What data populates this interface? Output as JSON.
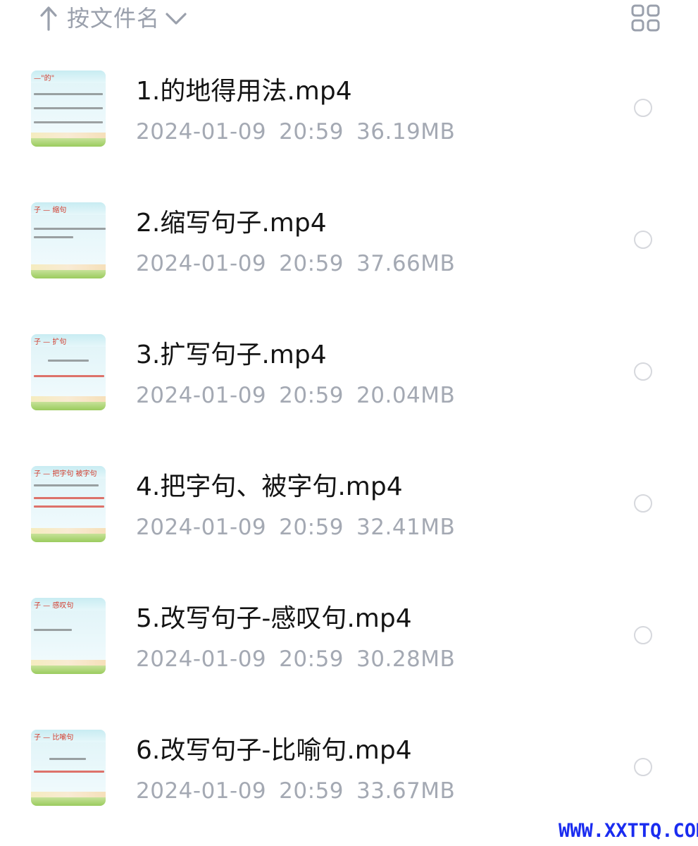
{
  "header": {
    "sort_label": "按文件名",
    "sort_direction_icon": "arrow-up-icon",
    "sort_menu_icon": "chevron-down-icon",
    "view_toggle_icon": "grid-view-icon"
  },
  "files": [
    {
      "name": "1.的地得用法.mp4",
      "date": "2024-01-09",
      "time": "20:59",
      "size": "36.19MB",
      "thumb_title": "—\"的\""
    },
    {
      "name": "2.缩写句子.mp4",
      "date": "2024-01-09",
      "time": "20:59",
      "size": "37.66MB",
      "thumb_title": "子 — 缩句"
    },
    {
      "name": "3.扩写句子.mp4",
      "date": "2024-01-09",
      "time": "20:59",
      "size": "20.04MB",
      "thumb_title": "子 — 扩句"
    },
    {
      "name": "4.把字句、被字句.mp4",
      "date": "2024-01-09",
      "time": "20:59",
      "size": "32.41MB",
      "thumb_title": "子 — 把字句  被字句"
    },
    {
      "name": "5.改写句子-感叹句.mp4",
      "date": "2024-01-09",
      "time": "20:59",
      "size": "30.28MB",
      "thumb_title": "子 — 感叹句"
    },
    {
      "name": "6.改写句子-比喻句.mp4",
      "date": "2024-01-09",
      "time": "20:59",
      "size": "33.67MB",
      "thumb_title": "子 — 比喻句"
    }
  ],
  "watermark": "WWW.XXTTQ.COM",
  "colors": {
    "name_text": "#141414",
    "meta_text": "#a4a9b3",
    "header_text": "#9aa0ac",
    "watermark": "#1a2cf0"
  }
}
